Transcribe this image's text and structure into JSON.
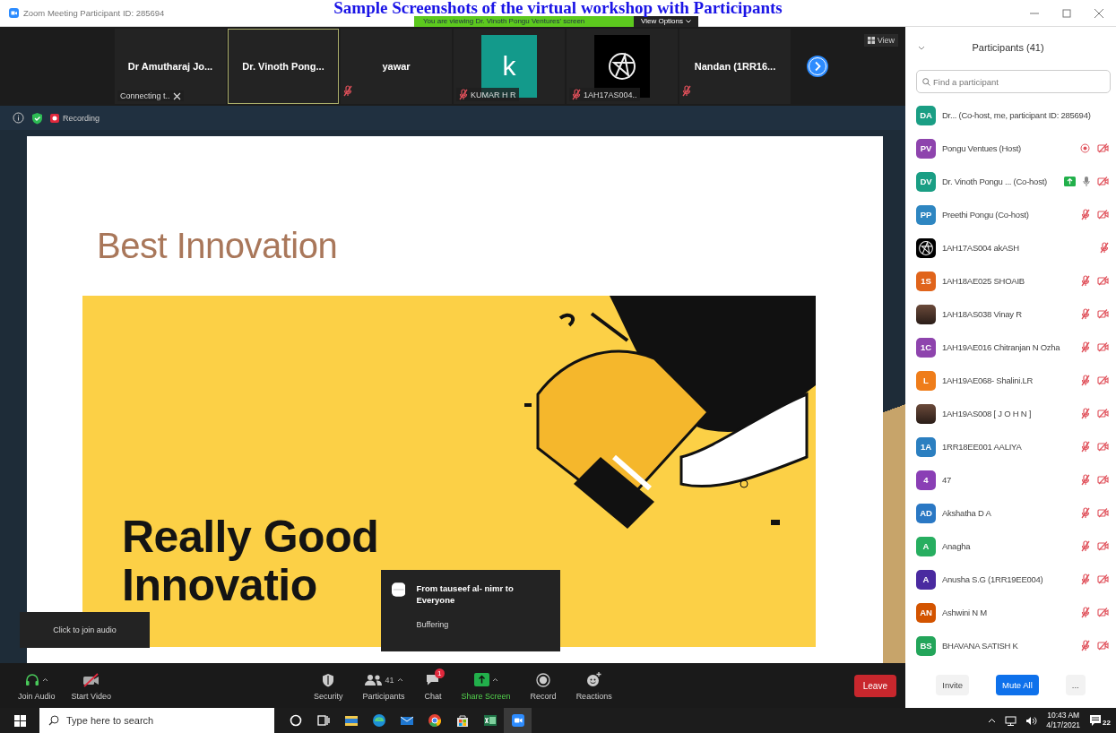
{
  "caption": "Sample Screenshots of the virtual workshop with Participants",
  "window": {
    "title": "Zoom Meeting Participant ID: 285694"
  },
  "banner": {
    "text": "You are viewing Dr. Vinoth Pongu Ventures' screen",
    "view_options": "View Options"
  },
  "thumbnails": [
    {
      "kind": "name",
      "name": "Dr Amutharaj Jo...",
      "status": "Connecting t..",
      "selected": false,
      "muted": false
    },
    {
      "kind": "name",
      "name": "Dr. Vinoth Pong...",
      "selected": true,
      "muted": false
    },
    {
      "kind": "name",
      "name": "yawar",
      "selected": false,
      "muted": true
    },
    {
      "kind": "letter",
      "letter": "k",
      "color": "#139a8b",
      "name": "KUMAR H R",
      "selected": false,
      "muted": true
    },
    {
      "kind": "logo",
      "name": "1AH17AS004..",
      "selected": false,
      "muted": true
    },
    {
      "kind": "name",
      "name": "Nandan (1RR16...",
      "selected": false,
      "muted": true
    }
  ],
  "view_button": "View",
  "meeting_bar": {
    "recording": "Recording"
  },
  "slide": {
    "title": "Best Innovation",
    "headline": [
      "Really Good",
      "Innovatio"
    ]
  },
  "tooltip": "Click to join audio",
  "chat_popup": {
    "title": "From tauseef al- nimr to Everyone",
    "message": "Buffering"
  },
  "toolbar": [
    {
      "kind": "join-audio",
      "label": "Join Audio"
    },
    {
      "kind": "start-video",
      "label": "Start Video"
    },
    {
      "kind": "security",
      "label": "Security"
    },
    {
      "kind": "participants",
      "label": "Participants",
      "count": "41"
    },
    {
      "kind": "chat",
      "label": "Chat",
      "badge": "1"
    },
    {
      "kind": "share-screen",
      "label": "Share Screen"
    },
    {
      "kind": "record",
      "label": "Record"
    },
    {
      "kind": "reactions",
      "label": "Reactions"
    }
  ],
  "leave": "Leave",
  "panel": {
    "title": "Participants (41)",
    "search_placeholder": "Find a participant",
    "participants": [
      {
        "kind": "initials",
        "initials": "DA",
        "color": "#1a9e84",
        "name": "Dr... (Co-host, me, participant ID: 285694)",
        "recording": false,
        "sharing": false,
        "mic_on": false,
        "muted": false,
        "video_off": false
      },
      {
        "kind": "initials",
        "initials": "PV",
        "color": "#8e44ad",
        "name": "Pongu Ventues (Host)",
        "recording": true,
        "sharing": false,
        "mic_on": false,
        "muted": false,
        "video_off": true
      },
      {
        "kind": "initials",
        "initials": "DV",
        "color": "#1a9e84",
        "name": "Dr. Vinoth Pongu ... (Co-host)",
        "recording": false,
        "sharing": true,
        "mic_on": true,
        "muted": false,
        "video_off": true
      },
      {
        "kind": "initials",
        "initials": "PP",
        "color": "#2e86c1",
        "name": "Preethi Pongu (Co-host)",
        "recording": false,
        "sharing": false,
        "mic_on": false,
        "muted": true,
        "video_off": true
      },
      {
        "kind": "logo",
        "name": "1AH17AS004 akASH",
        "recording": false,
        "sharing": false,
        "mic_on": false,
        "muted": true,
        "video_off": false
      },
      {
        "kind": "initials",
        "initials": "1S",
        "color": "#e0641b",
        "name": "1AH18AE025 SHOAIB",
        "recording": false,
        "sharing": false,
        "mic_on": false,
        "muted": true,
        "video_off": true
      },
      {
        "kind": "photo",
        "name": "1AH18AS038 Vinay R",
        "recording": false,
        "sharing": false,
        "mic_on": false,
        "muted": true,
        "video_off": true
      },
      {
        "kind": "initials",
        "initials": "1C",
        "color": "#8e44ad",
        "name": "1AH19AE016 Chitranjan N Ozha",
        "recording": false,
        "sharing": false,
        "mic_on": false,
        "muted": true,
        "video_off": true
      },
      {
        "kind": "initials",
        "initials": "L",
        "color": "#ef7d1a",
        "name": "1AH19AE068- Shalini.LR",
        "recording": false,
        "sharing": false,
        "mic_on": false,
        "muted": true,
        "video_off": true
      },
      {
        "kind": "photo",
        "name": "1AH19AS008 [ J O H N ]",
        "recording": false,
        "sharing": false,
        "mic_on": false,
        "muted": true,
        "video_off": true
      },
      {
        "kind": "initials",
        "initials": "1A",
        "color": "#2b7fc0",
        "name": "1RR18EE001 AALIYA",
        "recording": false,
        "sharing": false,
        "mic_on": false,
        "muted": true,
        "video_off": true
      },
      {
        "kind": "initials",
        "initials": "4",
        "color": "#8a3fb5",
        "name": "47",
        "recording": false,
        "sharing": false,
        "mic_on": false,
        "muted": true,
        "video_off": true
      },
      {
        "kind": "initials",
        "initials": "AD",
        "color": "#2a78c4",
        "name": "Akshatha D A",
        "recording": false,
        "sharing": false,
        "mic_on": false,
        "muted": true,
        "video_off": true
      },
      {
        "kind": "initials",
        "initials": "A",
        "color": "#27ae60",
        "name": "Anagha",
        "recording": false,
        "sharing": false,
        "mic_on": false,
        "muted": true,
        "video_off": true
      },
      {
        "kind": "initials",
        "initials": "A",
        "color": "#4a2aa0",
        "name": "Anusha S.G (1RR19EE004)",
        "recording": false,
        "sharing": false,
        "mic_on": false,
        "muted": true,
        "video_off": true
      },
      {
        "kind": "initials",
        "initials": "AN",
        "color": "#d35400",
        "name": "Ashwini N M",
        "recording": false,
        "sharing": false,
        "mic_on": false,
        "muted": true,
        "video_off": true
      },
      {
        "kind": "initials",
        "initials": "BS",
        "color": "#23a55a",
        "name": "BHAVANA SATISH K",
        "recording": false,
        "sharing": false,
        "mic_on": false,
        "muted": true,
        "video_off": true
      }
    ],
    "buttons": [
      {
        "kind": "plain",
        "label": "Invite"
      },
      {
        "kind": "primary",
        "label": "Mute All"
      },
      {
        "kind": "more",
        "label": "..."
      }
    ]
  },
  "taskbar": {
    "search_placeholder": "Type here to search",
    "apps": [
      {
        "kind": "cortana",
        "selected": false
      },
      {
        "kind": "task-view",
        "selected": false
      },
      {
        "kind": "file-explorer",
        "selected": false
      },
      {
        "kind": "edge",
        "selected": false
      },
      {
        "kind": "mail",
        "selected": false
      },
      {
        "kind": "chrome",
        "selected": false
      },
      {
        "kind": "store",
        "selected": false
      },
      {
        "kind": "excel",
        "selected": false
      },
      {
        "kind": "zoom",
        "selected": true
      }
    ],
    "time": "10:43 AM",
    "date": "4/17/2021",
    "notifications": "22"
  }
}
